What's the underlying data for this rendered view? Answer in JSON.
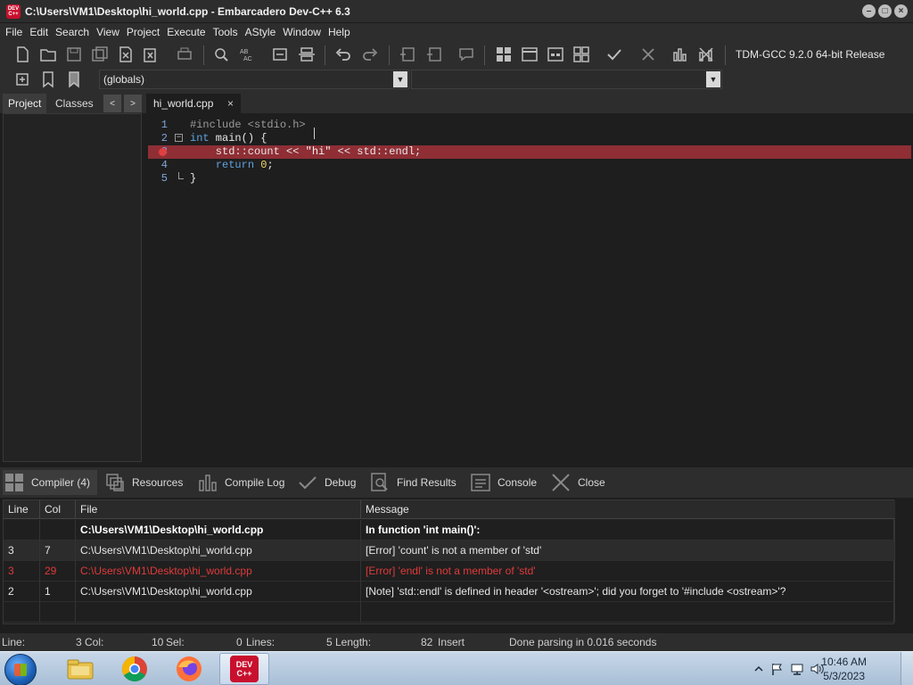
{
  "window": {
    "title": "C:\\Users\\VM1\\Desktop\\hi_world.cpp - Embarcadero Dev-C++ 6.3",
    "app_icon_text": "DEV C++"
  },
  "menu": [
    "File",
    "Edit",
    "Search",
    "View",
    "Project",
    "Execute",
    "Tools",
    "AStyle",
    "Window",
    "Help"
  ],
  "toolbar": {
    "compiler_label": "TDM-GCC 9.2.0 64-bit Release",
    "scope_combo": "(globals)",
    "function_combo": ""
  },
  "left_panel": {
    "tabs": [
      "Project",
      "Classes"
    ],
    "nav_prev": "<",
    "nav_next": ">"
  },
  "editor": {
    "tab_label": "hi_world.cpp",
    "tab_close": "×",
    "lines": [
      {
        "num": "1",
        "parts": [
          {
            "t": "#include <stdio.h>",
            "c": "pp"
          }
        ]
      },
      {
        "num": "2",
        "parts": [
          {
            "t": "int",
            "c": "kw"
          },
          {
            "t": " main() {",
            "c": ""
          }
        ]
      },
      {
        "num": "3",
        "parts": [
          {
            "t": "    std::count << ",
            "c": ""
          },
          {
            "t": "\"hi\"",
            "c": "str"
          },
          {
            "t": " << std::endl;",
            "c": ""
          }
        ],
        "error": true
      },
      {
        "num": "4",
        "parts": [
          {
            "t": "    ",
            "c": ""
          },
          {
            "t": "return",
            "c": "kw"
          },
          {
            "t": " ",
            "c": ""
          },
          {
            "t": "0",
            "c": "num"
          },
          {
            "t": ";",
            "c": ""
          }
        ]
      },
      {
        "num": "5",
        "parts": [
          {
            "t": "}",
            "c": ""
          }
        ]
      }
    ]
  },
  "bottom_tabs": [
    "Compiler (4)",
    "Resources",
    "Compile Log",
    "Debug",
    "Find Results",
    "Console",
    "Close"
  ],
  "messages": {
    "headers": [
      "Line",
      "Col",
      "File",
      "Message"
    ],
    "rows": [
      {
        "line": "",
        "col": "",
        "file": "C:\\Users\\VM1\\Desktop\\hi_world.cpp",
        "message": "In function 'int main()':",
        "style": "bold"
      },
      {
        "line": "3",
        "col": "7",
        "file": "C:\\Users\\VM1\\Desktop\\hi_world.cpp",
        "message": "[Error] 'count' is not a member of 'std'",
        "style": "hl"
      },
      {
        "line": "3",
        "col": "29",
        "file": "C:\\Users\\VM1\\Desktop\\hi_world.cpp",
        "message": "[Error] 'endl' is not a member of 'std'",
        "style": "err"
      },
      {
        "line": "2",
        "col": "1",
        "file": "C:\\Users\\VM1\\Desktop\\hi_world.cpp",
        "message": "[Note] 'std::endl' is defined in header '<ostream>'; did you forget to '#include <ostream>'?",
        "style": ""
      },
      {
        "line": "",
        "col": "",
        "file": "",
        "message": "",
        "style": ""
      }
    ]
  },
  "statusbar": {
    "line_label": "Line:",
    "line_val": "3",
    "col_label": "Col:",
    "col_val": "10",
    "sel_label": "Sel:",
    "sel_val": "0",
    "lines_label": "Lines:",
    "lines_val": "5",
    "length_label": "Length:",
    "length_val": "82",
    "mode": "Insert",
    "message": "Done parsing in 0.016 seconds"
  },
  "taskbar": {
    "time": "10:46 AM",
    "date": "5/3/2023",
    "apps": [
      "explorer-icon",
      "chrome-icon",
      "firefox-icon",
      "devcpp-icon"
    ]
  },
  "colors": {
    "error_line": "#8f2e35",
    "error_text": "#e03a3a",
    "keyword": "#5fa3e0",
    "line_number": "#7fa7d9"
  }
}
